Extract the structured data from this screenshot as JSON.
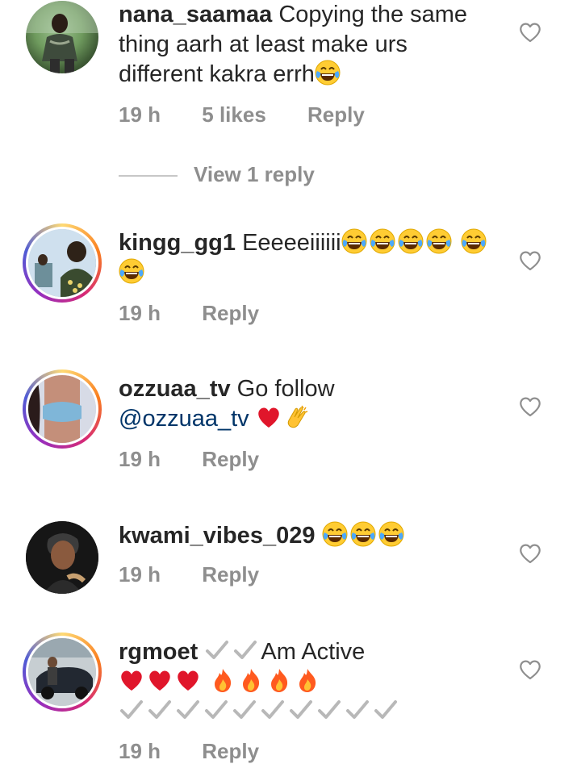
{
  "comments": [
    {
      "username": "nana_saamaa",
      "text": "Copying the same thing aarh at least make urs different kakra errh",
      "emojis": [
        "laughing-tears"
      ],
      "time": "19 h",
      "likes": "5 likes",
      "reply_label": "Reply",
      "view_replies": "View 1 reply",
      "has_story_ring": false
    },
    {
      "username": "kingg_gg1",
      "text": "Eeeeeiiiiii",
      "emojis": [
        "laughing-tears",
        "laughing-tears",
        "laughing-tears",
        "laughing-tears",
        "laughing-tears",
        "laughing-tears"
      ],
      "time": "19 h",
      "reply_label": "Reply",
      "has_story_ring": true
    },
    {
      "username": "ozzuaa_tv",
      "text": "Go follow",
      "mention": "@ozzuaa_tv",
      "emojis": [
        "red-heart",
        "clapping-hands"
      ],
      "time": "19 h",
      "reply_label": "Reply",
      "has_story_ring": true
    },
    {
      "username": "kwami_vibes_029",
      "text": "",
      "emojis": [
        "laughing-tears",
        "laughing-tears",
        "laughing-tears"
      ],
      "time": "19 h",
      "reply_label": "Reply",
      "has_story_ring": false
    },
    {
      "username": "rgmoet",
      "text": "Am Active",
      "emojis": [
        "check",
        "check",
        "red-heart",
        "red-heart",
        "red-heart",
        "fire",
        "fire",
        "fire",
        "fire",
        "check",
        "check",
        "check",
        "check",
        "check",
        "check",
        "check",
        "check",
        "check",
        "check"
      ],
      "time": "19 h",
      "reply_label": "Reply",
      "has_story_ring": true
    }
  ],
  "colors": {
    "meta_gray": "#8e8e8e",
    "mention_blue": "#003569",
    "text": "#262626"
  }
}
